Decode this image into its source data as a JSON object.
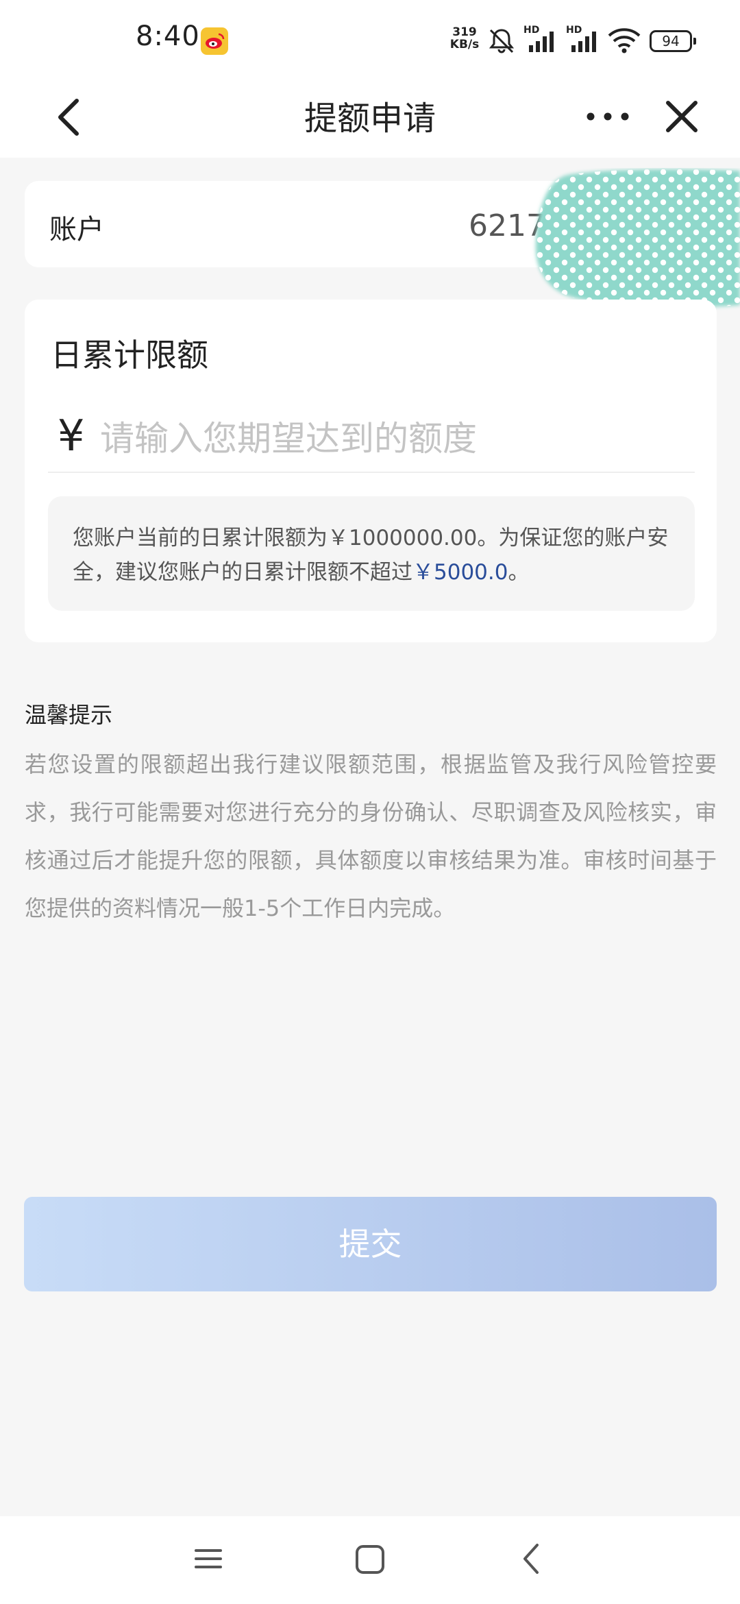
{
  "status_bar": {
    "time": "8:40",
    "notification_icon": "weibo-icon",
    "net_speed_value": "319",
    "net_speed_unit": "KB/s",
    "signal_1_tag": "HD",
    "signal_2_tag": "HD",
    "battery": "94"
  },
  "nav": {
    "title": "提额申请",
    "back_icon": "chevron-left-icon",
    "more_icon": "more-dots-icon",
    "close_icon": "close-icon"
  },
  "account": {
    "label": "账户",
    "number_visible": "6217"
  },
  "limit": {
    "title": "日累计限额",
    "currency_symbol": "¥",
    "input_value": "",
    "input_placeholder": "请输入您期望达到的额度",
    "notice_prefix": "您账户当前的日累计限额为￥1000000.00。为保证您的账户安全，建议您账户的日累计限额不超过",
    "notice_amount": "￥5000.0",
    "notice_suffix": "。"
  },
  "tips": {
    "title": "温馨提示",
    "body": "若您设置的限额超出我行建议限额范围，根据监管及我行风险管控要求，我行可能需要对您进行充分的身份确认、尽职调查及风险核实，审核通过后才能提升您的限额，具体额度以审核结果为准。审核时间基于您提供的资料情况一般1-5个工作日内完成。"
  },
  "submit": {
    "label": "提交",
    "enabled": false
  },
  "system_nav": {
    "menu_icon": "menu-icon",
    "home_icon": "home-square-icon",
    "back_icon": "back-chevron-icon"
  },
  "colors": {
    "page_bg": "#f6f6f6",
    "card_bg": "#ffffff",
    "highlight_blue": "#2a4d9a",
    "submit_gradient_start": "#c8dcf7",
    "submit_gradient_end": "#aabfe8",
    "overlay_teal": "#8fd8cb",
    "tips_text": "#999999"
  }
}
